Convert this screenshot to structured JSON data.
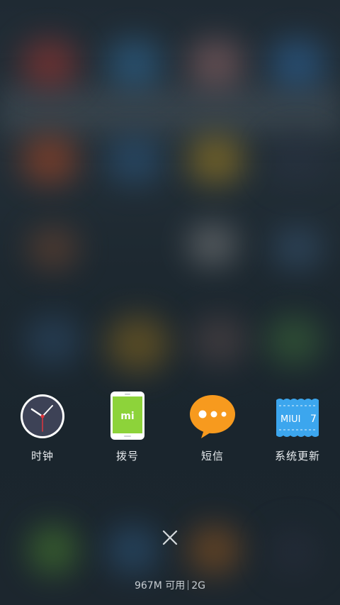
{
  "recent_apps": [
    {
      "label": "时钟",
      "icon": "clock-icon"
    },
    {
      "label": "拨号",
      "icon": "dialer-phone-icon",
      "brand_text": "mi"
    },
    {
      "label": "短信",
      "icon": "message-bubble-icon"
    },
    {
      "label": "系统更新",
      "icon": "system-update-ticket-icon",
      "badge_text": "MIUI",
      "badge_number": "7"
    }
  ],
  "controls": {
    "close_icon": "close-icon"
  },
  "memory": {
    "available": "967M 可用",
    "total": "2G"
  },
  "colors": {
    "clock_face": "#3d4256",
    "clock_hand_red": "#e0353d",
    "dialer_green": "#8dd33a",
    "message_orange": "#f79a1e",
    "update_blue": "#3ca6ee"
  }
}
